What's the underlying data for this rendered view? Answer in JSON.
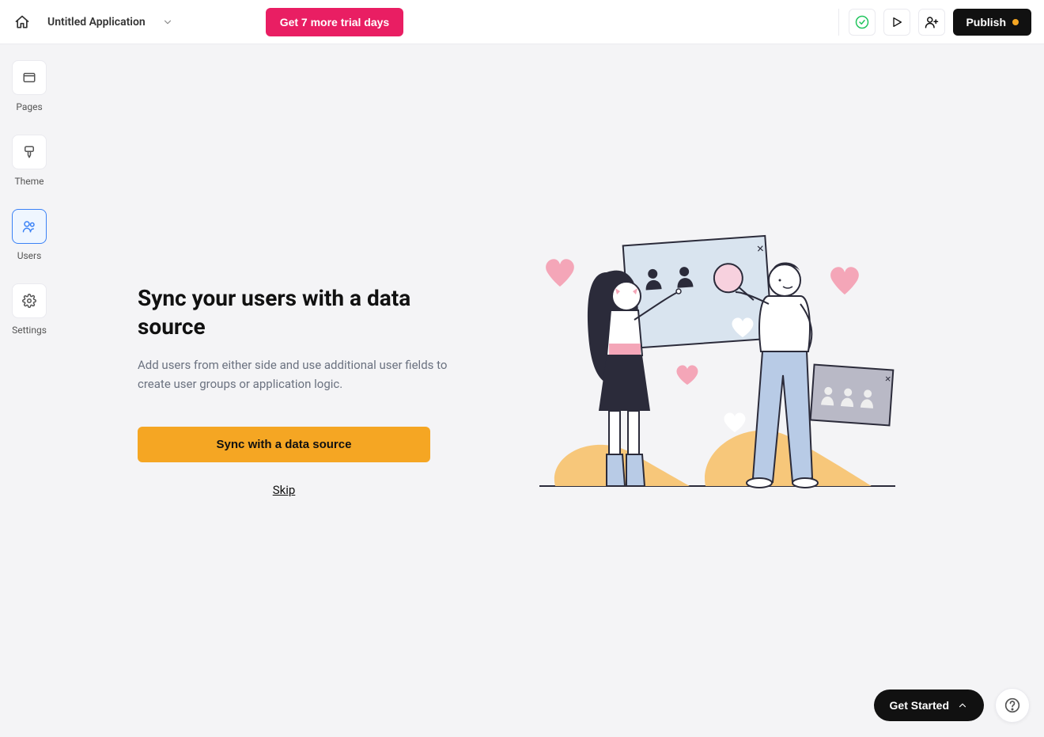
{
  "header": {
    "app_title": "Untitled Application",
    "trial_button": "Get 7 more trial days",
    "publish_button": "Publish"
  },
  "sidebar": {
    "items": [
      {
        "label": "Pages",
        "icon": "pages-icon",
        "active": false
      },
      {
        "label": "Theme",
        "icon": "theme-icon",
        "active": false
      },
      {
        "label": "Users",
        "icon": "users-icon",
        "active": true
      },
      {
        "label": "Settings",
        "icon": "settings-icon",
        "active": false
      }
    ]
  },
  "main": {
    "headline": "Sync your users with a data source",
    "subtext": "Add users from either side and use additional user fields to create user groups or application logic.",
    "sync_button": "Sync with a data source",
    "skip_link": "Skip"
  },
  "footer": {
    "get_started": "Get Started"
  },
  "colors": {
    "accent_pink": "#e91e63",
    "accent_orange": "#f5a623",
    "accent_blue": "#3b82f6",
    "success_green": "#22c55e",
    "dark": "#111111"
  }
}
